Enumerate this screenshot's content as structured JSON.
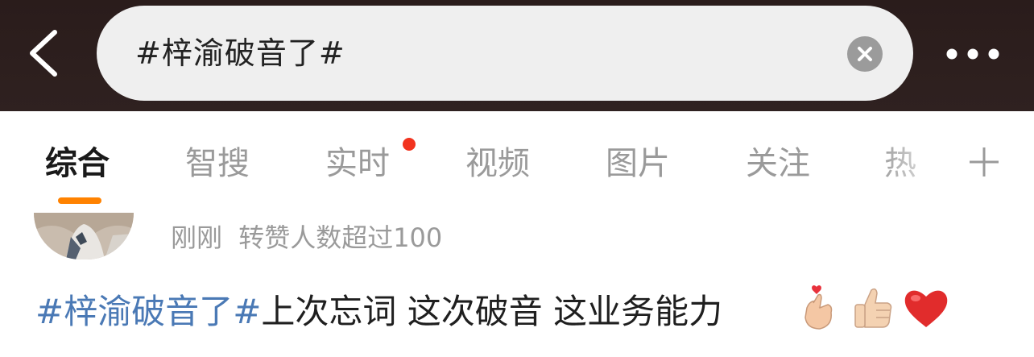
{
  "search": {
    "query": "#梓渝破音了#"
  },
  "icons": {
    "back": "chevron-left-icon",
    "clear": "clear-x-icon",
    "more": "more-dots-icon",
    "add_tab": "plus-icon"
  },
  "tabs": [
    {
      "label": "综合",
      "active": true
    },
    {
      "label": "智搜",
      "active": false
    },
    {
      "label": "实时",
      "active": false,
      "badge": "red-dot"
    },
    {
      "label": "视频",
      "active": false
    },
    {
      "label": "图片",
      "active": false
    },
    {
      "label": "关注",
      "active": false
    },
    {
      "label": "热",
      "active": false
    }
  ],
  "post": {
    "time": "刚刚",
    "status": "转赞人数超过100",
    "hashtag": "#梓渝破音了#",
    "text": "上次忘词 这次破音 这业务能力",
    "emojis": [
      "finger-heart-emoji",
      "thumbs-up-emoji",
      "red-heart-emoji"
    ]
  },
  "colors": {
    "topbar": "#2f2120",
    "accent": "#ff8200",
    "link": "#4a79b5",
    "badge": "#f2331f"
  }
}
